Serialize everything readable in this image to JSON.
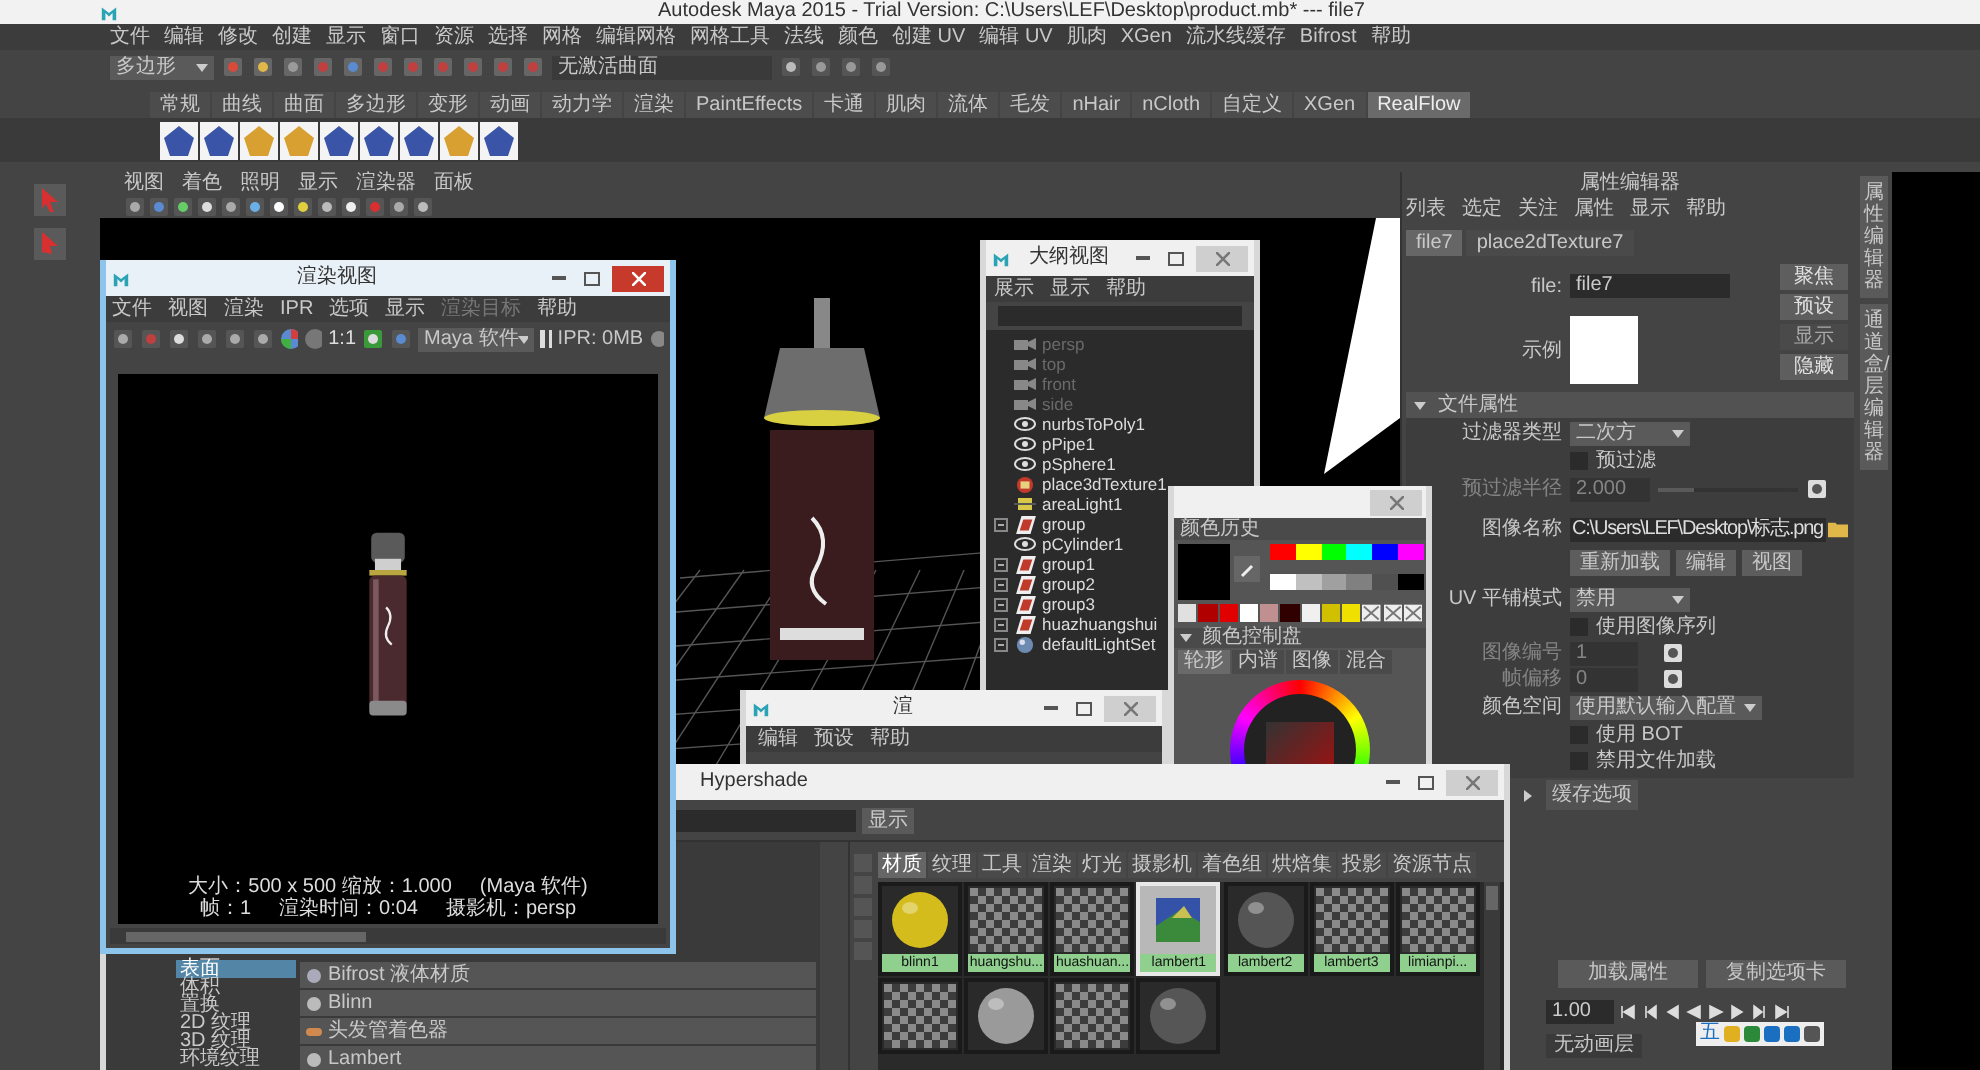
{
  "main_window": {
    "title": "Autodesk Maya 2015 - Trial Version: C:\\Users\\LEF\\Desktop\\product.mb*   ---   file7"
  },
  "menu_bar": [
    "文件",
    "编辑",
    "修改",
    "创建",
    "显示",
    "窗口",
    "资源",
    "选择",
    "网格",
    "编辑网格",
    "网格工具",
    "法线",
    "颜色",
    "创建 UV",
    "编辑 UV",
    "肌肉",
    "XGen",
    "流水线缓存",
    "Bifrost",
    "帮助"
  ],
  "status_line": {
    "mode": "多边形",
    "surface_field": "无激活曲面"
  },
  "shelf_tabs": [
    {
      "label": "常规",
      "selected": false
    },
    {
      "label": "曲线",
      "selected": false
    },
    {
      "label": "曲面",
      "selected": false
    },
    {
      "label": "多边形",
      "selected": false
    },
    {
      "label": "变形",
      "selected": false
    },
    {
      "label": "动画",
      "selected": false
    },
    {
      "label": "动力学",
      "selected": false
    },
    {
      "label": "渲染",
      "selected": false
    },
    {
      "label": "PaintEffects",
      "selected": false
    },
    {
      "label": "卡通",
      "selected": false
    },
    {
      "label": "肌肉",
      "selected": false
    },
    {
      "label": "流体",
      "selected": false
    },
    {
      "label": "毛发",
      "selected": false
    },
    {
      "label": "nHair",
      "selected": false
    },
    {
      "label": "nCloth",
      "selected": false
    },
    {
      "label": "自定义",
      "selected": false
    },
    {
      "label": "XGen",
      "selected": false
    },
    {
      "label": "RealFlow",
      "selected": true
    }
  ],
  "viewport": {
    "menu": [
      "视图",
      "着色",
      "照明",
      "显示",
      "渲染器",
      "面板"
    ]
  },
  "attribute_editor": {
    "title": "属性编辑器",
    "menu": [
      "列表",
      "选定",
      "关注",
      "属性",
      "显示",
      "帮助"
    ],
    "tabs": [
      {
        "label": "file7",
        "selected": true
      },
      {
        "label": "place2dTexture7",
        "selected": false
      }
    ],
    "node_label": "file:",
    "node_name": "file7",
    "side_buttons": [
      {
        "label": "聚焦",
        "disabled": false
      },
      {
        "label": "预设",
        "disabled": false
      },
      {
        "label": "显示",
        "disabled": true
      },
      {
        "label": "隐藏",
        "disabled": false
      }
    ],
    "sample_label": "示例",
    "section": {
      "title": "文件属性",
      "expanded": true
    },
    "rows": [
      {
        "kind": "dropdown",
        "label": "过滤器类型",
        "value": "二次方",
        "disabled": false
      },
      {
        "kind": "checkbox",
        "label": "预过滤",
        "checked": false,
        "disabled": false
      },
      {
        "kind": "slider",
        "label": "预过滤半径",
        "value": "2.000",
        "level": 0.25,
        "disabled": true
      },
      {
        "kind": "path",
        "label": "图像名称",
        "value": "C:\\Users\\LEF\\Desktop\\标志.png",
        "disabled": false
      },
      {
        "kind": "buttons",
        "buttons": [
          "重新加载",
          "编辑",
          "视图"
        ]
      },
      {
        "kind": "dropdown",
        "label": "UV 平铺模式",
        "value": "禁用",
        "disabled": false
      },
      {
        "kind": "checkbox",
        "label": "使用图像序列",
        "checked": false,
        "disabled": false
      },
      {
        "kind": "number",
        "label": "图像编号",
        "value": "1",
        "disabled": true
      },
      {
        "kind": "number",
        "label": "帧偏移",
        "value": "0",
        "disabled": true
      },
      {
        "kind": "dropdown",
        "label": "颜色空间",
        "value": "使用默认输入配置",
        "disabled": false
      },
      {
        "kind": "checkbox",
        "label": "使用 BOT",
        "checked": false,
        "disabled": false
      },
      {
        "kind": "checkbox",
        "label": "禁用文件加载",
        "checked": false,
        "disabled": false
      }
    ],
    "section_2": {
      "title": "缓存选项",
      "expanded": false
    },
    "bottom_buttons": [
      "加载属性",
      "复制选项卡"
    ],
    "time_field": "1.00",
    "anim_layer": "无动画层"
  },
  "side_tabs": [
    "属性编辑器",
    "通道盒/层编辑器"
  ],
  "ime_bar": {
    "label": "五"
  },
  "render_view": {
    "title": "渲染视图",
    "active": true,
    "menu": [
      {
        "label": "文件",
        "disabled": false
      },
      {
        "label": "视图",
        "disabled": false
      },
      {
        "label": "渲染",
        "disabled": false
      },
      {
        "label": "IPR",
        "disabled": false
      },
      {
        "label": "选项",
        "disabled": false
      },
      {
        "label": "显示",
        "disabled": false
      },
      {
        "label": "渲染目标",
        "disabled": true
      },
      {
        "label": "帮助",
        "disabled": false
      }
    ],
    "ratio_button": "1:1",
    "renderer": "Maya 软件",
    "ipr_memory": "IPR: 0MB",
    "info_line_1": [
      "大小：500 x 500  缩放：1.000",
      "(Maya 软件)"
    ],
    "info_line_2": [
      "帧：1",
      "渲染时间：0:04",
      "摄影机：persp"
    ]
  },
  "outliner": {
    "title": "大纲视图",
    "active": false,
    "menu": [
      "展示",
      "显示",
      "帮助"
    ],
    "items": [
      {
        "label": "persp",
        "kind": "camera",
        "dimmed": true,
        "expandable": false
      },
      {
        "label": "top",
        "kind": "camera",
        "dimmed": true,
        "expandable": false
      },
      {
        "label": "front",
        "kind": "camera",
        "dimmed": true,
        "expandable": false
      },
      {
        "label": "side",
        "kind": "camera",
        "dimmed": true,
        "expandable": false
      },
      {
        "label": "nurbsToPoly1",
        "kind": "mesh",
        "dimmed": false,
        "expandable": false
      },
      {
        "label": "pPipe1",
        "kind": "mesh",
        "dimmed": false,
        "expandable": false
      },
      {
        "label": "pSphere1",
        "kind": "mesh",
        "dimmed": false,
        "expandable": false
      },
      {
        "label": "place3dTexture1",
        "kind": "texture",
        "dimmed": false,
        "expandable": false
      },
      {
        "label": "areaLight1",
        "kind": "light",
        "dimmed": false,
        "expandable": false
      },
      {
        "label": "group",
        "kind": "group",
        "dimmed": false,
        "expandable": true
      },
      {
        "label": "pCylinder1",
        "kind": "mesh",
        "dimmed": false,
        "expandable": false
      },
      {
        "label": "group1",
        "kind": "group",
        "dimmed": false,
        "expandable": true
      },
      {
        "label": "group2",
        "kind": "group",
        "dimmed": false,
        "expandable": true
      },
      {
        "label": "group3",
        "kind": "group",
        "dimmed": false,
        "expandable": true
      },
      {
        "label": "huazhuangshui",
        "kind": "group",
        "dimmed": false,
        "expandable": true
      },
      {
        "label": "defaultLightSet",
        "kind": "set",
        "dimmed": false,
        "expandable": true
      }
    ]
  },
  "color_chooser": {
    "active": false,
    "history_title": "颜色历史",
    "palette": [
      {
        "kind": "color",
        "color": "#ff0000"
      },
      {
        "kind": "color",
        "color": "#ffff00"
      },
      {
        "kind": "color",
        "color": "#00ff00"
      },
      {
        "kind": "color",
        "color": "#00ffff"
      },
      {
        "kind": "color",
        "color": "#0000ff"
      },
      {
        "kind": "color",
        "color": "#ff00ff"
      },
      {
        "kind": "color",
        "color": "#ffffff"
      },
      {
        "kind": "color",
        "color": "#c0c0c0"
      },
      {
        "kind": "color",
        "color": "#a0a0a0"
      },
      {
        "kind": "color",
        "color": "#808080"
      },
      {
        "kind": "color",
        "color": "#505050"
      },
      {
        "kind": "color",
        "color": "#000000"
      }
    ],
    "history": [
      {
        "kind": "color",
        "color": "#e0e0e0"
      },
      {
        "kind": "color",
        "color": "#b00000"
      },
      {
        "kind": "color",
        "color": "#e00000"
      },
      {
        "kind": "color",
        "color": "#ffffff"
      },
      {
        "kind": "color",
        "color": "#c09090"
      },
      {
        "kind": "color",
        "color": "#300000"
      },
      {
        "kind": "color",
        "color": "#f0f0f0"
      },
      {
        "kind": "color",
        "color": "#d0c000"
      },
      {
        "kind": "color",
        "color": "#f0e000"
      },
      {
        "kind": "empty"
      },
      {
        "kind": "empty"
      },
      {
        "kind": "empty"
      }
    ],
    "wheel_title": "颜色控制盘",
    "tabs": [
      {
        "label": "轮形",
        "selected": true
      },
      {
        "label": "内谱",
        "selected": false
      },
      {
        "label": "图像",
        "selected": false
      },
      {
        "label": "混合",
        "selected": false
      }
    ]
  },
  "render_settings": {
    "title": "渲",
    "active": false,
    "menu": [
      "编辑",
      "预设",
      "帮助"
    ]
  },
  "hypershade": {
    "title": "Hypershade",
    "active": false,
    "show_button": "显示",
    "categories": [
      {
        "label": "表面",
        "selected": true
      },
      {
        "label": "体积",
        "selected": false
      },
      {
        "label": "置换",
        "selected": false
      },
      {
        "label": "2D 纹理",
        "selected": false
      },
      {
        "label": "3D 纹理",
        "selected": false
      },
      {
        "label": "环境纹理",
        "selected": false
      }
    ],
    "nodes": [
      {
        "label": "Bifrost 液体材质",
        "kind": "liquid"
      },
      {
        "label": "Blinn",
        "kind": "sphere"
      },
      {
        "label": "头发管着色器",
        "kind": "hair"
      },
      {
        "label": "Lambert",
        "kind": "sphere"
      }
    ],
    "tabs": [
      {
        "label": "材质",
        "selected": true
      },
      {
        "label": "纹理",
        "selected": false
      },
      {
        "label": "工具",
        "selected": false
      },
      {
        "label": "渲染",
        "selected": false
      },
      {
        "label": "灯光",
        "selected": false
      },
      {
        "label": "摄影机",
        "selected": false
      },
      {
        "label": "着色组",
        "selected": false
      },
      {
        "label": "烘焙集",
        "selected": false
      },
      {
        "label": "投影",
        "selected": false
      },
      {
        "label": "资源节点",
        "selected": false
      }
    ],
    "swatches": [
      {
        "label": "blinn1",
        "kind": "sphere",
        "color": "#d4bc1c",
        "selected": false
      },
      {
        "label": "huangshu...",
        "kind": "checker",
        "selected": false
      },
      {
        "label": "huashuan...",
        "kind": "checker",
        "selected": false
      },
      {
        "label": "lambert1",
        "kind": "texture",
        "selected": true
      },
      {
        "label": "lambert2",
        "kind": "sphere",
        "color": "#555555",
        "selected": false
      },
      {
        "label": "lambert3",
        "kind": "checker",
        "selected": false
      },
      {
        "label": "limianpi...",
        "kind": "checker",
        "selected": false
      },
      {
        "kind": "checker",
        "selected": false
      },
      {
        "kind": "sphere",
        "color": "#9a9a9a",
        "selected": false
      },
      {
        "kind": "checker",
        "selected": false
      },
      {
        "kind": "sphere",
        "color": "#565656",
        "selected": false
      }
    ]
  }
}
